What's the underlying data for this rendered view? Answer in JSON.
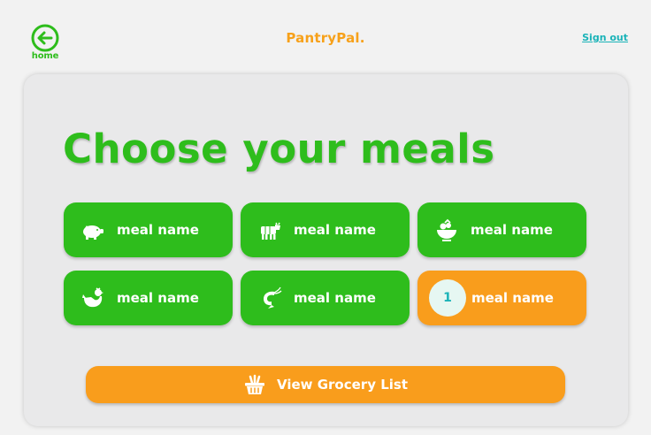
{
  "header": {
    "home_label": "home",
    "brand": "PantryPal.",
    "signout_label": "Sign out"
  },
  "main": {
    "heading": "Choose your meals",
    "meals": [
      {
        "label": "meal name",
        "icon": "pig-icon",
        "selected": false
      },
      {
        "label": "meal name",
        "icon": "cow-icon",
        "selected": false
      },
      {
        "label": "meal name",
        "icon": "salad-bowl-icon",
        "selected": false
      },
      {
        "label": "meal name",
        "icon": "chicken-icon",
        "selected": false
      },
      {
        "label": "meal name",
        "icon": "shrimp-icon",
        "selected": false
      },
      {
        "label": "meal name",
        "icon": "selected-count-badge",
        "selected": true,
        "count": "1"
      }
    ],
    "grocery_button_label": "View Grocery List"
  },
  "colors": {
    "green": "#2ebd1c",
    "orange": "#f99d1c",
    "teal": "#1ab3b8",
    "card_bg": "#e9e9ea",
    "page_bg": "#f2f2f2"
  }
}
